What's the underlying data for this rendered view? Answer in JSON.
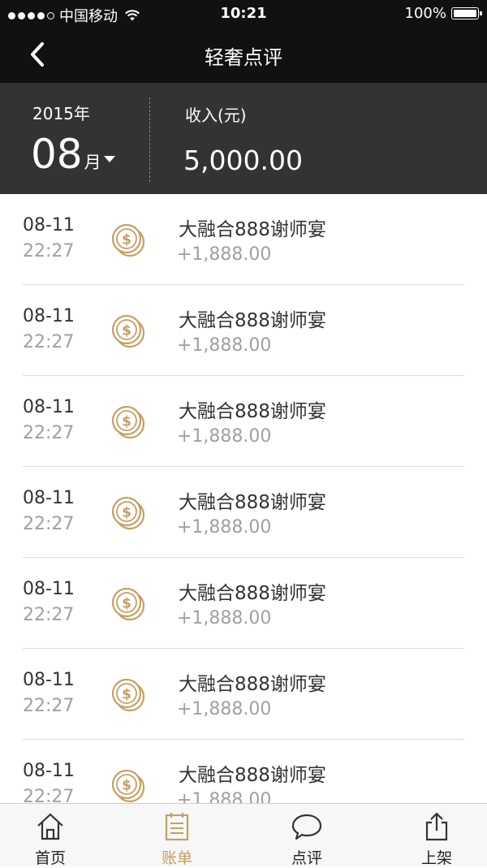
{
  "status_bar": {
    "carrier": "中国移动",
    "time": "10:21",
    "battery": "100%"
  },
  "nav": {
    "title": "轻奢点评"
  },
  "summary": {
    "year": "2015年",
    "month": "08",
    "month_unit": "月",
    "income_label": "收入(元)",
    "income_value": "5,000.00"
  },
  "transactions": [
    {
      "date": "08-11",
      "time": "22:27",
      "name": "大融合888谢师宴",
      "amount": "+1,888.00"
    },
    {
      "date": "08-11",
      "time": "22:27",
      "name": "大融合888谢师宴",
      "amount": "+1,888.00"
    },
    {
      "date": "08-11",
      "time": "22:27",
      "name": "大融合888谢师宴",
      "amount": "+1,888.00"
    },
    {
      "date": "08-11",
      "time": "22:27",
      "name": "大融合888谢师宴",
      "amount": "+1,888.00"
    },
    {
      "date": "08-11",
      "time": "22:27",
      "name": "大融合888谢师宴",
      "amount": "+1,888.00"
    },
    {
      "date": "08-11",
      "time": "22:27",
      "name": "大融合888谢师宴",
      "amount": "+1,888.00"
    },
    {
      "date": "08-11",
      "time": "22:27",
      "name": "大融合888谢师宴",
      "amount": "+1,888.00"
    }
  ],
  "tabs": [
    {
      "label": "首页",
      "icon": "home-icon",
      "active": false
    },
    {
      "label": "账单",
      "icon": "bill-icon",
      "active": true
    },
    {
      "label": "点评",
      "icon": "chat-bubble-icon",
      "active": false
    },
    {
      "label": "上架",
      "icon": "share-upload-icon",
      "active": false
    }
  ],
  "colors": {
    "header_bg": "#111111",
    "summary_bg": "#333333",
    "accent_gold": "#c4a062",
    "secondary_text": "#a0a0a0"
  }
}
